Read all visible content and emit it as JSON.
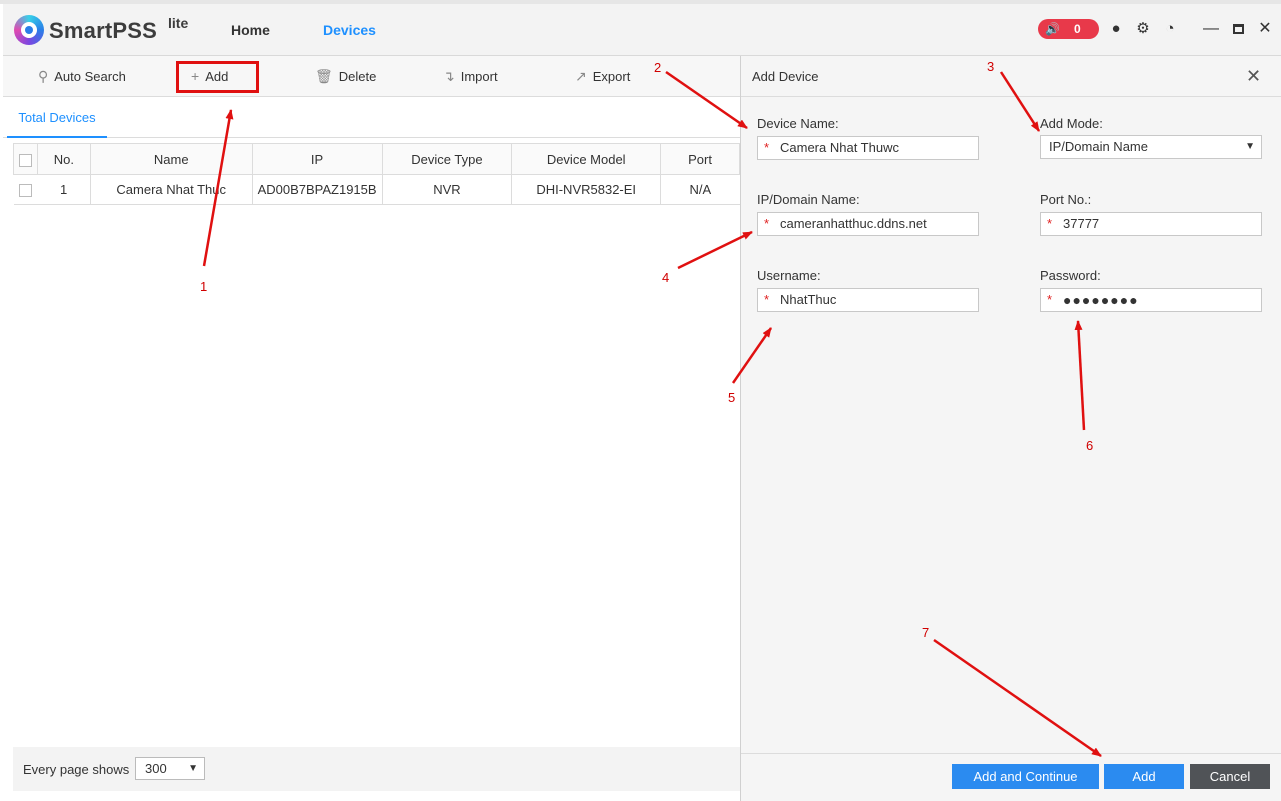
{
  "app": {
    "name": "SmartPSS",
    "edition": "lite",
    "nav": {
      "home": "Home",
      "devices": "Devices"
    },
    "alarm_count": "0"
  },
  "toolbar": {
    "auto_search": "Auto Search",
    "add": "Add",
    "delete": "Delete",
    "import": "Import",
    "export": "Export"
  },
  "tabs": {
    "total_devices": "Total Devices"
  },
  "table": {
    "headers": {
      "no": "No.",
      "name": "Name",
      "ip": "IP",
      "device_type": "Device Type",
      "device_model": "Device Model",
      "port": "Port"
    },
    "rows": [
      {
        "no": "1",
        "name": "Camera Nhat Thuc",
        "ip": "AD00B7BPAZ1915B",
        "device_type": "NVR",
        "device_model": "DHI-NVR5832-EI",
        "port": "N/A"
      }
    ]
  },
  "pager": {
    "label": "Every page shows",
    "page_size": "300"
  },
  "dialog": {
    "title": "Add Device",
    "device_name_label": "Device Name:",
    "device_name_value": "Camera Nhat Thuwc",
    "add_mode_label": "Add Mode:",
    "add_mode_value": "IP/Domain Name",
    "ip_label": "IP/Domain Name:",
    "ip_value": "cameranhatthuc.ddns.net",
    "port_label": "Port No.:",
    "port_value": "37777",
    "username_label": "Username:",
    "username_value": "NhatThuc",
    "password_label": "Password:",
    "password_value": "●●●●●●●●",
    "required_mark": "*",
    "buttons": {
      "add_continue": "Add and Continue",
      "add": "Add",
      "cancel": "Cancel"
    }
  },
  "annotations": {
    "color": "#e01010",
    "steps": [
      "1",
      "2",
      "3",
      "4",
      "5",
      "6",
      "7"
    ]
  },
  "icons": {
    "alarm": "speaker-icon",
    "user": "user-icon",
    "settings": "gear-icon",
    "performance": "gauge-icon"
  }
}
